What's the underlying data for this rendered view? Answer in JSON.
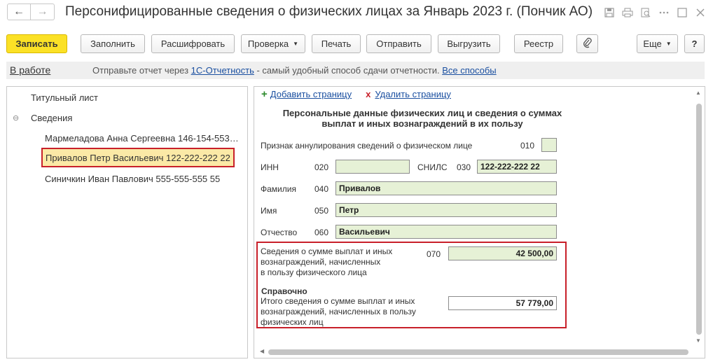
{
  "window": {
    "title": "Персонифицированные сведения о физических лицах за Январь 2023 г. (Пончик АО)",
    "back_glyph": "←",
    "forward_glyph": "→",
    "icons": [
      "save-icon",
      "print-icon",
      "search-icon",
      "more-icon",
      "maximize-icon",
      "close-icon"
    ]
  },
  "toolbar": {
    "save_label": "Записать",
    "fill_label": "Заполнить",
    "decode_label": "Расшифровать",
    "check_label": "Проверка",
    "print_label": "Печать",
    "send_label": "Отправить",
    "export_label": "Выгрузить",
    "registry_label": "Реестр",
    "more_label": "Еще",
    "help_label": "?"
  },
  "infobar": {
    "status": "В работе",
    "text_before": "Отправьте отчет через ",
    "link1": "1С-Отчетность",
    "text_middle": " - самый удобный способ сдачи отчетности. ",
    "link2": "Все способы"
  },
  "tree": {
    "title_page": "Титульный лист",
    "group": "Сведения",
    "group_toggle": "⊖",
    "people": [
      "Мармеладова Анна Сергеевна 146-154-553…",
      "Привалов Петр Васильевич 122-222-222 22",
      "Синичкин Иван Павлович 555-555-555 55"
    ],
    "selected_index": 1
  },
  "page_actions": {
    "add": "Добавить страницу",
    "delete": "Удалить страницу"
  },
  "form": {
    "heading_line1": "Персональные данные физических лиц и сведения о суммах",
    "heading_line2": "выплат и иных вознаграждений в их пользу",
    "annul_label": "Признак аннулирования сведений о физическом лице",
    "annul_code": "010",
    "inn_label": "ИНН",
    "inn_code": "020",
    "inn_value": "",
    "snils_label": "СНИЛС",
    "snils_code": "030",
    "snils_value": "122-222-222 22",
    "surname_label": "Фамилия",
    "surname_code": "040",
    "surname_value": "Привалов",
    "name_label": "Имя",
    "name_code": "050",
    "name_value": "Петр",
    "patronymic_label": "Отчество",
    "patronymic_code": "060",
    "patronymic_value": "Васильевич",
    "payments_label_l1": "Сведения о сумме выплат и иных",
    "payments_label_l2": "вознаграждений, начисленных",
    "payments_label_l3": "в пользу физического лица",
    "payments_code": "070",
    "payments_value": "42 500,00",
    "reference_heading": "Справочно",
    "total_label_l1": "Итого сведения о сумме выплат и иных",
    "total_label_l2": "вознаграждений, начисленных в пользу",
    "total_label_l3": "физических лиц",
    "total_value": "57 779,00"
  }
}
